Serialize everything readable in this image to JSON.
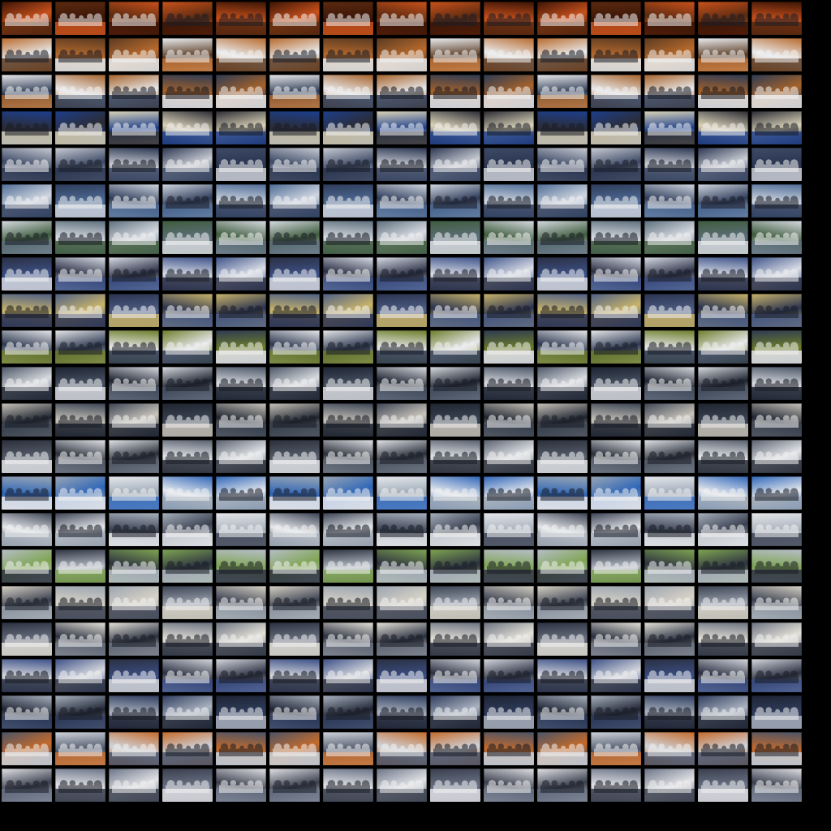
{
  "sheet": {
    "columns": 15,
    "rows": 22,
    "background": "#000000",
    "row_palettes": [
      [
        "#3a1406",
        "#c8511b",
        "#5b2a10"
      ],
      [
        "#5a3a22",
        "#b86a2c",
        "#e9ecef"
      ],
      [
        "#2d3b55",
        "#a5622a",
        "#e8e8ea"
      ],
      [
        "#1d3f8c",
        "#2b2b33",
        "#d9d2b8"
      ],
      [
        "#2a3550",
        "#c9ccd4",
        "#3d4a66"
      ],
      [
        "#4f6c96",
        "#cfd6e0",
        "#2e3c5a"
      ],
      [
        "#5d6f7c",
        "#d7dbe2",
        "#3f5d3e"
      ],
      [
        "#3d5288",
        "#d8dce6",
        "#2a2f44"
      ],
      [
        "#4e5f86",
        "#c9b46a",
        "#2b3350"
      ],
      [
        "#6c7d2a",
        "#e6e7ea",
        "#2e3a52"
      ],
      [
        "#4a5566",
        "#d9dbe0",
        "#1c2230"
      ],
      [
        "#3c4554",
        "#c8c3ba",
        "#1f2530"
      ],
      [
        "#58606e",
        "#e2e4e8",
        "#2a2f3a"
      ],
      [
        "#9aa6b4",
        "#2f66b8",
        "#e6e9ee"
      ],
      [
        "#a7b0bc",
        "#3a4152",
        "#e5e7eb"
      ],
      [
        "#b6bec8",
        "#7fa552",
        "#2d3340"
      ],
      [
        "#9ba4b0",
        "#d7d2c6",
        "#3b4150"
      ],
      [
        "#6b7280",
        "#e4e1d8",
        "#2b3140"
      ],
      [
        "#3b4f86",
        "#d6d8de",
        "#2a3042"
      ],
      [
        "#2f3d5e",
        "#aab2c0",
        "#1e2433"
      ],
      [
        "#4a5468",
        "#c46a2a",
        "#cfd3da"
      ],
      [
        "#6a7386",
        "#e2e2e6",
        "#3a3f4e"
      ]
    ]
  }
}
